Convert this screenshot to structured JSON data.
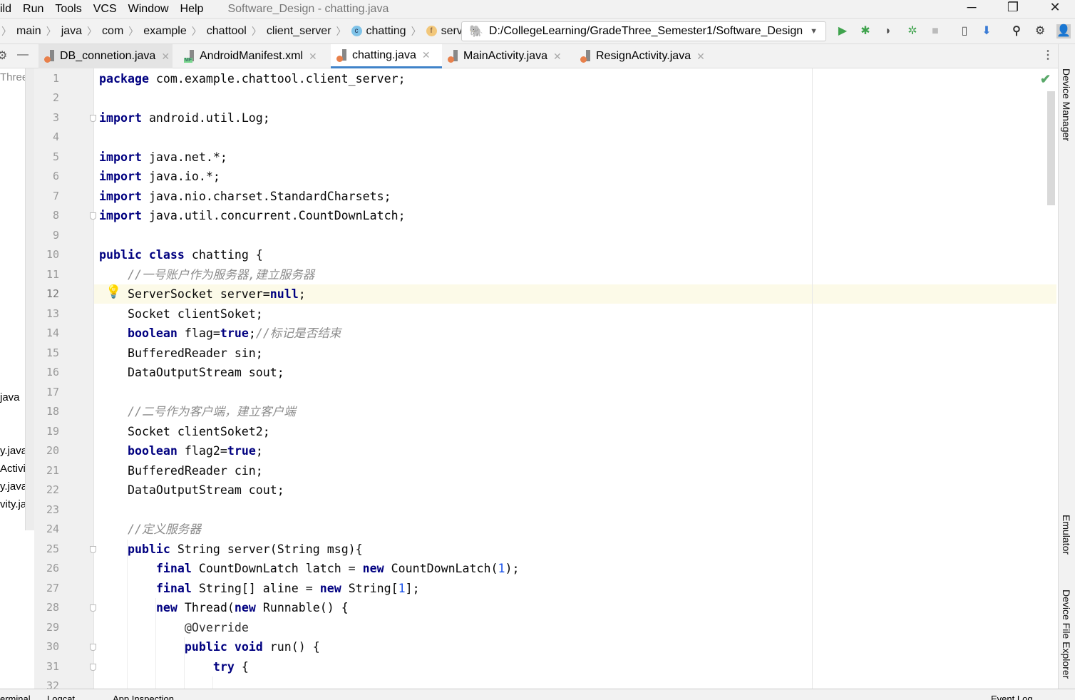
{
  "menu": {
    "items": [
      "ild",
      "Run",
      "Tools",
      "VCS",
      "Window",
      "Help"
    ],
    "title": "Software_Design - chatting.java"
  },
  "window": {
    "minimize": "─",
    "restore": "❐",
    "close": "✕"
  },
  "breadcrumb": [
    "main",
    "java",
    "com",
    "example",
    "chattool",
    "client_server",
    "chatting",
    "server"
  ],
  "breadcrumb_icons": {
    "chatting": "c",
    "server": "f"
  },
  "run_config": {
    "path": "D:/CollegeLearning/GradeThree_Semester1/Software_Design",
    "icon": "gradle-elephant-icon"
  },
  "toolbar": [
    "run-icon",
    "debug-icon",
    "coverage-icon",
    "attach-debugger-icon",
    "stop-icon",
    "device-manager-icon",
    "sdk-manager-icon",
    "search-icon",
    "settings-icon",
    "avatar-icon"
  ],
  "tabs": [
    {
      "label": "DB_connetion.java",
      "active": false
    },
    {
      "label": "AndroidManifest.xml",
      "active": false,
      "badge": "MF"
    },
    {
      "label": "chatting.java",
      "active": true
    },
    {
      "label": "MainActivity.java",
      "active": false
    },
    {
      "label": "ResignActivity.java",
      "active": false
    }
  ],
  "project_panel": [
    "Three_S",
    "java",
    "y.java",
    "Activit",
    "y.java",
    "vity.java"
  ],
  "editor": {
    "current_line": 12,
    "inspection_status": "ok",
    "lines": [
      [
        [
          "k",
          "package"
        ],
        [
          "p",
          " com.example.chattool.client_server;"
        ]
      ],
      [],
      [
        [
          "k",
          "import"
        ],
        [
          "p",
          " android.util.Log;"
        ]
      ],
      [],
      [
        [
          "k",
          "import"
        ],
        [
          "p",
          " java.net.*;"
        ]
      ],
      [
        [
          "k",
          "import"
        ],
        [
          "p",
          " java.io.*;"
        ]
      ],
      [
        [
          "k",
          "import"
        ],
        [
          "p",
          " java.nio.charset.StandardCharsets;"
        ]
      ],
      [
        [
          "k",
          "import"
        ],
        [
          "p",
          " java.util.concurrent.CountDownLatch;"
        ]
      ],
      [],
      [
        [
          "k",
          "public class"
        ],
        [
          "p",
          " chatting {"
        ]
      ],
      [
        [
          "p",
          "    "
        ],
        [
          "c",
          "//一号账户作为服务器,建立服务器"
        ]
      ],
      [
        [
          "p",
          "    ServerSocket server="
        ],
        [
          "k",
          "null"
        ],
        [
          "p",
          ";"
        ]
      ],
      [
        [
          "p",
          "    Socket clientSoket;"
        ]
      ],
      [
        [
          "p",
          "    "
        ],
        [
          "k",
          "boolean"
        ],
        [
          "p",
          " flag="
        ],
        [
          "k",
          "true"
        ],
        [
          "p",
          ";"
        ],
        [
          "c",
          "//标记是否结束"
        ]
      ],
      [
        [
          "p",
          "    BufferedReader sin;"
        ]
      ],
      [
        [
          "p",
          "    DataOutputStream sout;"
        ]
      ],
      [],
      [
        [
          "p",
          "    "
        ],
        [
          "c",
          "//二号作为客户端，建立客户端"
        ]
      ],
      [
        [
          "p",
          "    Socket clientSoket2;"
        ]
      ],
      [
        [
          "p",
          "    "
        ],
        [
          "k",
          "boolean"
        ],
        [
          "p",
          " flag2="
        ],
        [
          "k",
          "true"
        ],
        [
          "p",
          ";"
        ]
      ],
      [
        [
          "p",
          "    BufferedReader cin;"
        ]
      ],
      [
        [
          "p",
          "    DataOutputStream cout;"
        ]
      ],
      [],
      [
        [
          "p",
          "    "
        ],
        [
          "c",
          "//定义服务器"
        ]
      ],
      [
        [
          "p",
          "    "
        ],
        [
          "k",
          "public"
        ],
        [
          "p",
          " String server(String msg){"
        ]
      ],
      [
        [
          "p",
          "        "
        ],
        [
          "k",
          "final"
        ],
        [
          "p",
          " CountDownLatch latch = "
        ],
        [
          "k",
          "new"
        ],
        [
          "p",
          " CountDownLatch("
        ],
        [
          "n",
          "1"
        ],
        [
          "p",
          ");"
        ]
      ],
      [
        [
          "p",
          "        "
        ],
        [
          "k",
          "final"
        ],
        [
          "p",
          " String[] aline = "
        ],
        [
          "k",
          "new"
        ],
        [
          "p",
          " String["
        ],
        [
          "n",
          "1"
        ],
        [
          "p",
          "];"
        ]
      ],
      [
        [
          "p",
          "        "
        ],
        [
          "k",
          "new"
        ],
        [
          "p",
          " Thread("
        ],
        [
          "k",
          "new"
        ],
        [
          "p",
          " Runnable() {"
        ]
      ],
      [
        [
          "p",
          "            "
        ],
        [
          "a",
          "@Override"
        ]
      ],
      [
        [
          "p",
          "            "
        ],
        [
          "k",
          "public void"
        ],
        [
          "p",
          " run() {"
        ]
      ],
      [
        [
          "p",
          "                "
        ],
        [
          "k",
          "try"
        ],
        [
          "p",
          " {"
        ]
      ],
      []
    ]
  },
  "right_tools": [
    "Device Manager",
    "Emulator",
    "Device File Explorer"
  ],
  "bottom_tools": [
    "erminal",
    "Logcat",
    "App Inspection",
    "Event Log"
  ]
}
